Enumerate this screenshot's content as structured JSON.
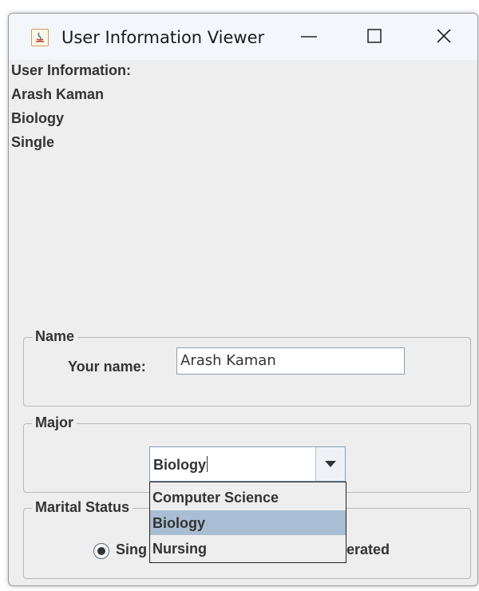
{
  "window": {
    "title": "User Information Viewer",
    "minimize_icon": "minimize-icon",
    "maximize_icon": "maximize-icon",
    "close_icon": "close-icon",
    "app_icon": "java-app-icon"
  },
  "info": {
    "heading": "User Information:",
    "name": "Arash Kaman",
    "major": "Biology",
    "marital_status": "Single"
  },
  "name_group": {
    "legend": "Name",
    "label": "Your name:",
    "value": "Arash Kaman"
  },
  "major_group": {
    "legend": "Major",
    "selected": "Biology",
    "options": [
      "Computer Science",
      "Biology",
      "Nursing"
    ],
    "highlighted_index": 1
  },
  "marital_group": {
    "legend": "Marital Status",
    "option_single_visible": "Sing",
    "option_separated_visible": "erated",
    "selected": "Single"
  },
  "colors": {
    "window_bg": "#eeeeee",
    "highlight": "#a9bed4",
    "text": "#333333"
  }
}
